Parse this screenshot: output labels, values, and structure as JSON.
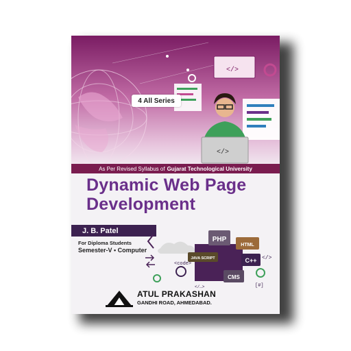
{
  "cover": {
    "series_label": "4 All Series",
    "syllabus_prefix": "As Per Revised Syllabus of",
    "syllabus_university": "Gujarat Technological University",
    "title_line1": "Dynamic Web Page",
    "title_line2": "Development",
    "author": "J. B. Patel",
    "audience": "For Diploma Students",
    "semester": "Semester-V • Computer",
    "publisher_name": "ATUL PRAKASHAN",
    "publisher_address": "GANDHI ROAD, AHMEDABAD."
  },
  "tech_labels": [
    "PHP",
    "HTML",
    "JAVA SCRIPT",
    "C++",
    "CMS",
    "<code>",
    "</>",
    "[#]",
    "</…>"
  ],
  "colors": {
    "title": "#6a2f8a",
    "magenta": "#7a1c63",
    "author_bar": "#3c2150",
    "tech_block": "#4a2257"
  }
}
